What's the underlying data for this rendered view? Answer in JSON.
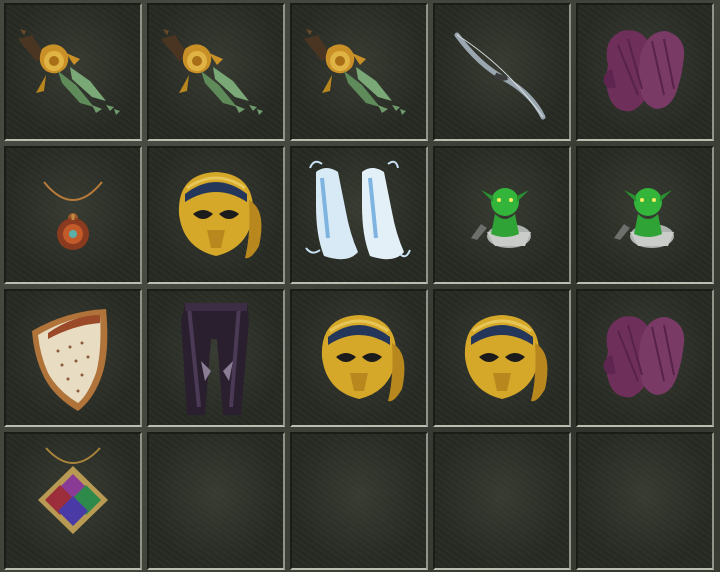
{
  "inventory": {
    "rows": 4,
    "columns": 5,
    "slots": [
      {
        "item": "sword-icon"
      },
      {
        "item": "sword-icon"
      },
      {
        "item": "sword-icon"
      },
      {
        "item": "bow-icon"
      },
      {
        "item": "gauntlets-icon"
      },
      {
        "item": "amulet-icon"
      },
      {
        "item": "helmet-icon"
      },
      {
        "item": "boots-icon"
      },
      {
        "item": "goblin-figure-icon"
      },
      {
        "item": "goblin-figure-icon"
      },
      {
        "item": "shield-icon"
      },
      {
        "item": "leggings-icon"
      },
      {
        "item": "helmet-icon"
      },
      {
        "item": "helmet-icon"
      },
      {
        "item": "gauntlets-icon"
      },
      {
        "item": "gem-pendant-icon"
      },
      {
        "item": ""
      },
      {
        "item": ""
      },
      {
        "item": ""
      },
      {
        "item": ""
      }
    ]
  },
  "colors": {
    "background": "#40443a",
    "slot": "#262a23",
    "slot_highlight": "#b9beb1",
    "gold": "#c9962a",
    "green_blade": "#5f8a5a",
    "purple_glove": "#7a3a66",
    "goblin_green": "#33b43a"
  }
}
